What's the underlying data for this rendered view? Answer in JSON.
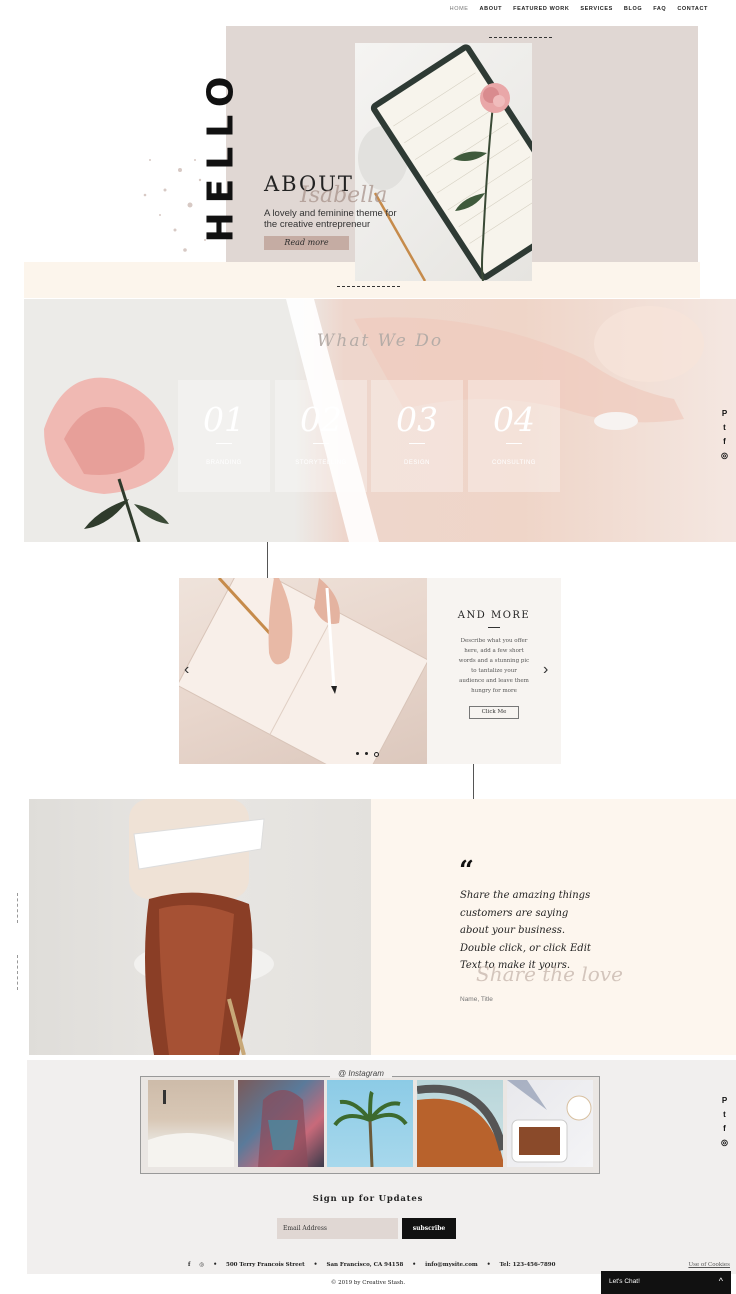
{
  "nav": {
    "items": [
      "HOME",
      "ABOUT",
      "FEATURED WORK",
      "SERVICES",
      "BLOG",
      "FAQ",
      "CONTACT"
    ]
  },
  "hero": {
    "hello": "HELLO",
    "about_title": "ABOUT",
    "script_name": "Isabella",
    "subtitle_line1": "A lovely and feminine theme for",
    "subtitle_line2": "the creative entrepreneur",
    "read_more": "Read more"
  },
  "services": {
    "title": "What We Do",
    "cards": [
      {
        "num": "01",
        "label": "BRANDING"
      },
      {
        "num": "02",
        "label": "STORYTELLING"
      },
      {
        "num": "03",
        "label": "DESIGN"
      },
      {
        "num": "04",
        "label": "CONSULTING"
      }
    ]
  },
  "social_icons": [
    "pinterest-icon",
    "twitter-icon",
    "facebook-icon",
    "instagram-icon"
  ],
  "slider": {
    "heading": "AND MORE",
    "description": "Describe what you offer here, add a few short words and a stunning pic to tantalize your audience and leave them hungry for more",
    "button": "Click Me",
    "active_slide": 1,
    "slide_count": 3
  },
  "testimonial": {
    "quote_mark": "“",
    "quote": "Share the amazing things customers are saying about your business. Double click, or click Edit Text to make it yours.",
    "script": "Share the love",
    "name": "Name, Title"
  },
  "instagram": {
    "label": "@ Instagram",
    "tiles": [
      "beach-photo",
      "scarf-photo",
      "palm-tree-photo",
      "architecture-photo",
      "food-photo"
    ]
  },
  "footer": {
    "signup_title": "Sign up for Updates",
    "email_placeholder": "Email Address",
    "subscribe": "subscribe",
    "address": "500 Terry Francois Street",
    "city": "San Francisco, CA 94158",
    "email": "info@mysite.com",
    "phone": "Tel: 123-456-7890",
    "cookies": "Use of Cookies",
    "copyright": "© 2019 by Creative Stash."
  },
  "chat": {
    "label": "Let's Chat!",
    "chevron": "^"
  },
  "colors": {
    "hero_bg": "#e0d7d3",
    "cream": "#fcf5ec",
    "button_rose": "#c5aca3",
    "black": "#111111"
  }
}
